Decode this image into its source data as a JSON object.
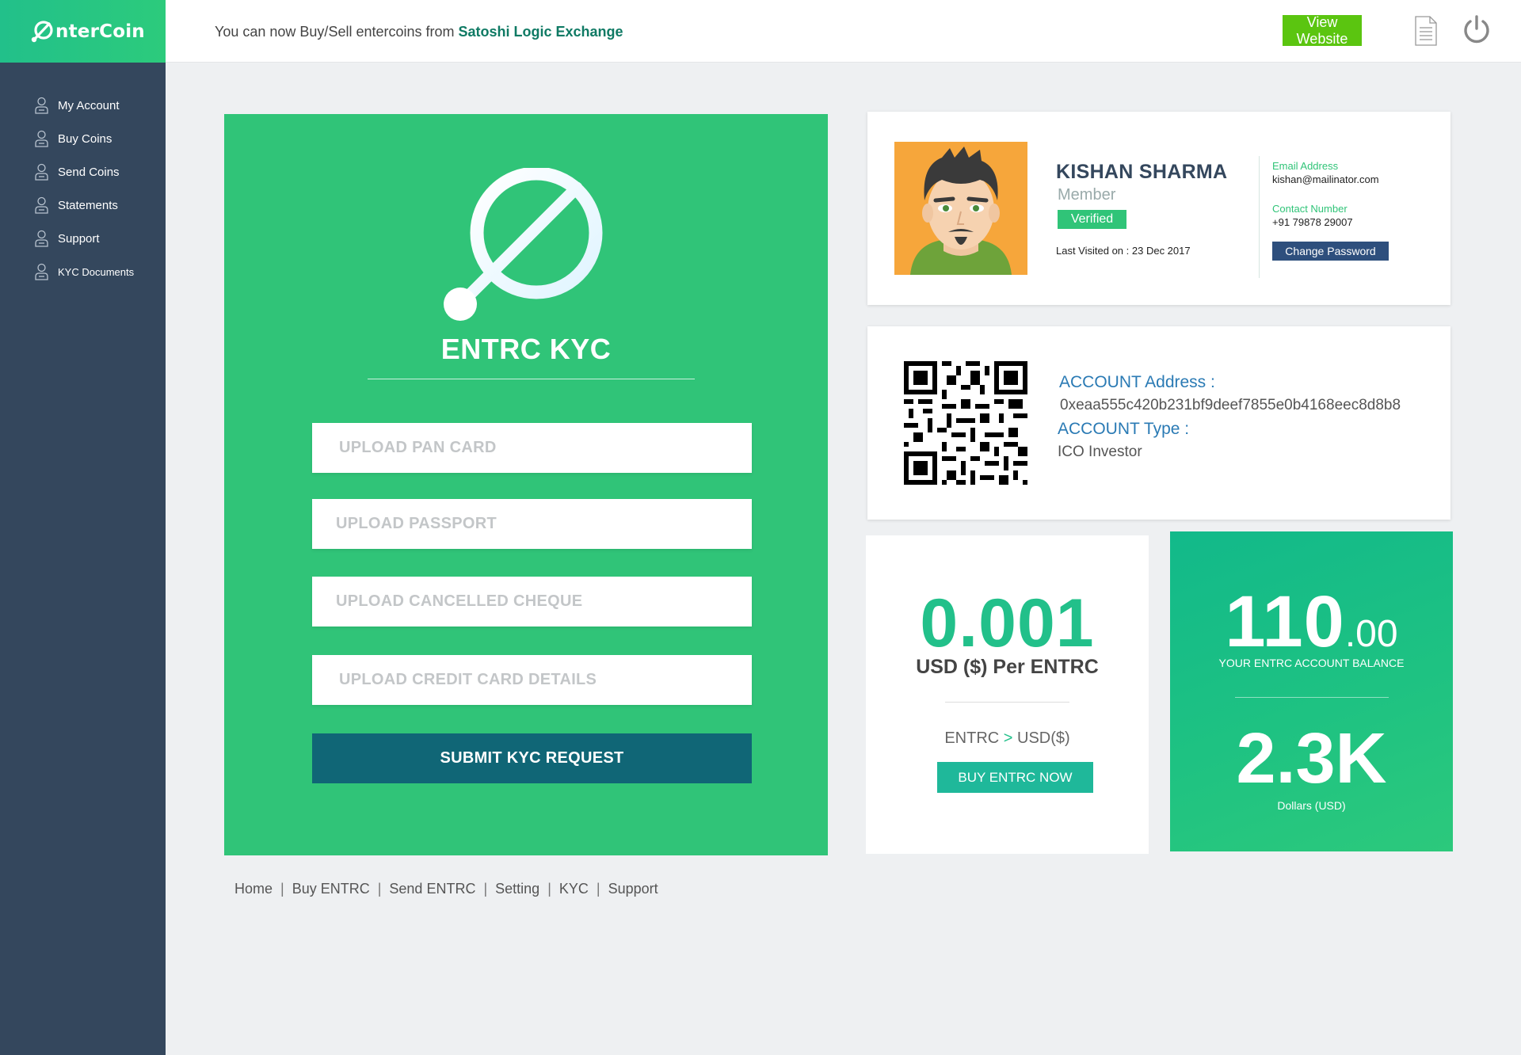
{
  "brand": {
    "name": "nterCoin"
  },
  "sidebar": {
    "items": [
      {
        "label": "My Account"
      },
      {
        "label": "Buy Coins"
      },
      {
        "label": "Send Coins"
      },
      {
        "label": "Statements"
      },
      {
        "label": "Support"
      },
      {
        "label": "KYC Documents"
      }
    ]
  },
  "header": {
    "announcement_prefix": "You can now Buy/Sell entercoins from ",
    "announcement_link": "Satoshi Logic Exchange",
    "view_website": "View Website"
  },
  "kyc": {
    "title": "ENTRC KYC",
    "uploads": [
      "UPLOAD PAN CARD",
      "UPLOAD PASSPORT",
      "UPLOAD CANCELLED CHEQUE",
      "UPLOAD CREDIT CARD DETAILS"
    ],
    "submit": "SUBMIT KYC REQUEST"
  },
  "footer": {
    "links": [
      "Home",
      "Buy ENTRC",
      "Send ENTRC",
      "Setting",
      "KYC",
      "Support"
    ]
  },
  "profile": {
    "name": "KISHAN SHARMA",
    "role": "Member",
    "status": "Verified",
    "last_visited": "Last Visited on : 23 Dec 2017",
    "email_label": "Email Address",
    "email": "kishan@mailinator.com",
    "contact_label": "Contact Number",
    "contact": "+91 79878 29007",
    "change_password": "Change Password"
  },
  "account": {
    "address_label": "ACCOUNT Address :",
    "address": "0xeaa555c420b231bf9deef7855e0b4168eec8d8b8",
    "type_label": "ACCOUNT Type :",
    "type": "ICO Investor"
  },
  "price": {
    "value": "0.001",
    "unit": "USD ($) Per ENTRC",
    "conv_from": "ENTRC",
    "conv_arrow": ">",
    "conv_to": "USD($)",
    "buy": "BUY ENTRC NOW"
  },
  "balance": {
    "int": "110",
    "dec": ".00",
    "label": "YOUR ENTRC ACCOUNT BALANCE",
    "usd_value": "2.3K",
    "usd_label": "Dollars (USD)"
  },
  "colors": {
    "brand_green": "#30c478",
    "sidebar": "#34475d",
    "submit": "#106676",
    "view_button": "#5bc510",
    "link_blue": "#2a7ab4"
  },
  "icons": [
    "entercoin-logo-icon",
    "user-icon",
    "document-icon",
    "power-icon",
    "qr-code"
  ]
}
